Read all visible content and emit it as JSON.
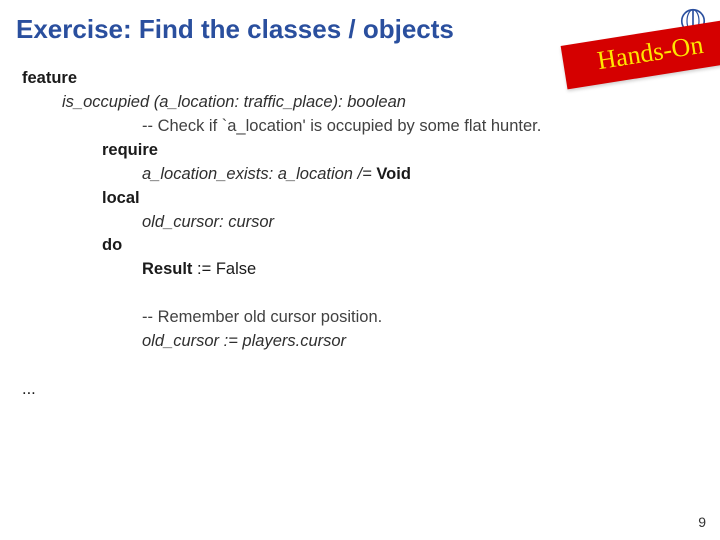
{
  "title": "Exercise: Find the classes / objects",
  "banner": "Hands-On",
  "page_number": "9",
  "code": {
    "feature_kw": "feature",
    "sig_name": "is_occupied (a_location: traffic_place): boolean",
    "comment1": "-- Check if `a_location' is occupied by some flat hunter.",
    "require_kw": "require",
    "require_body_pre": "a_location_exists: a_location /= ",
    "void_kw": "Void",
    "local_kw": "local",
    "local_body": "old_cursor: cursor",
    "do_kw": "do",
    "result_kw": "Result",
    "result_rest": " := False",
    "comment2": "-- Remember old cursor position.",
    "assign_line": "old_cursor := players.cursor",
    "ellipsis": "..."
  }
}
